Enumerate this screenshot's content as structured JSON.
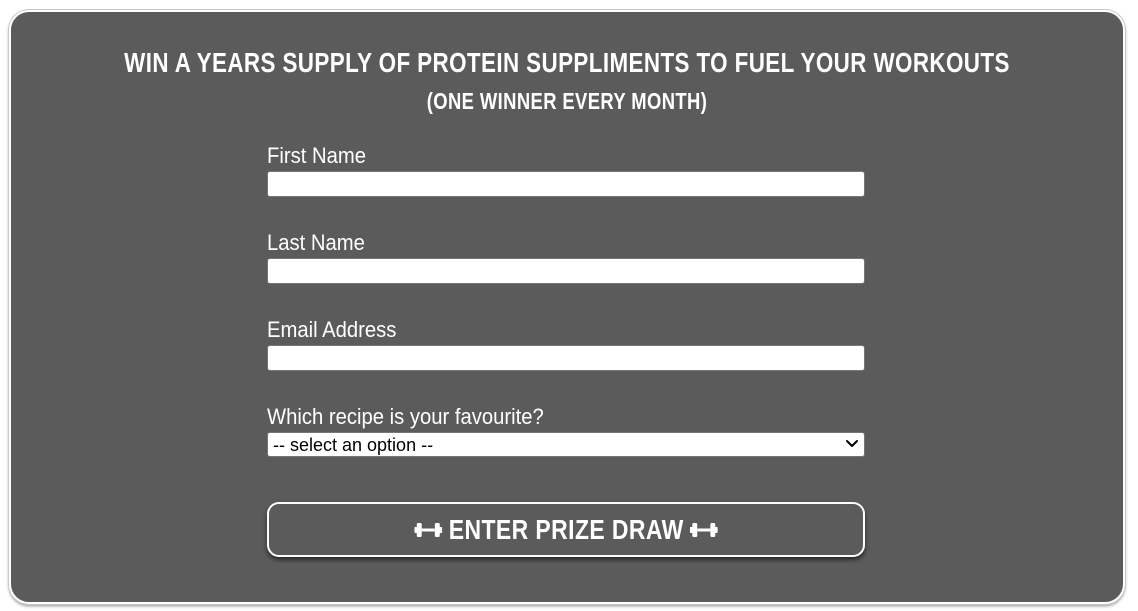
{
  "form": {
    "title": "WIN A YEARS SUPPLY OF PROTEIN SUPPLIMENTS TO FUEL YOUR WORKOUTS",
    "subtitle": "(ONE WINNER EVERY MONTH)",
    "first_name": {
      "label": "First Name",
      "value": ""
    },
    "last_name": {
      "label": "Last Name",
      "value": ""
    },
    "email": {
      "label": "Email Address",
      "value": ""
    },
    "recipe": {
      "label": "Which recipe is your favourite?",
      "selected": "-- select an option --"
    },
    "submit_label": "ENTER PRIZE DRAW",
    "submit_icon": "dumbbell-icon"
  },
  "colors": {
    "card_background": "#5b5b5b",
    "text": "#ffffff",
    "input_background": "#ffffff"
  }
}
